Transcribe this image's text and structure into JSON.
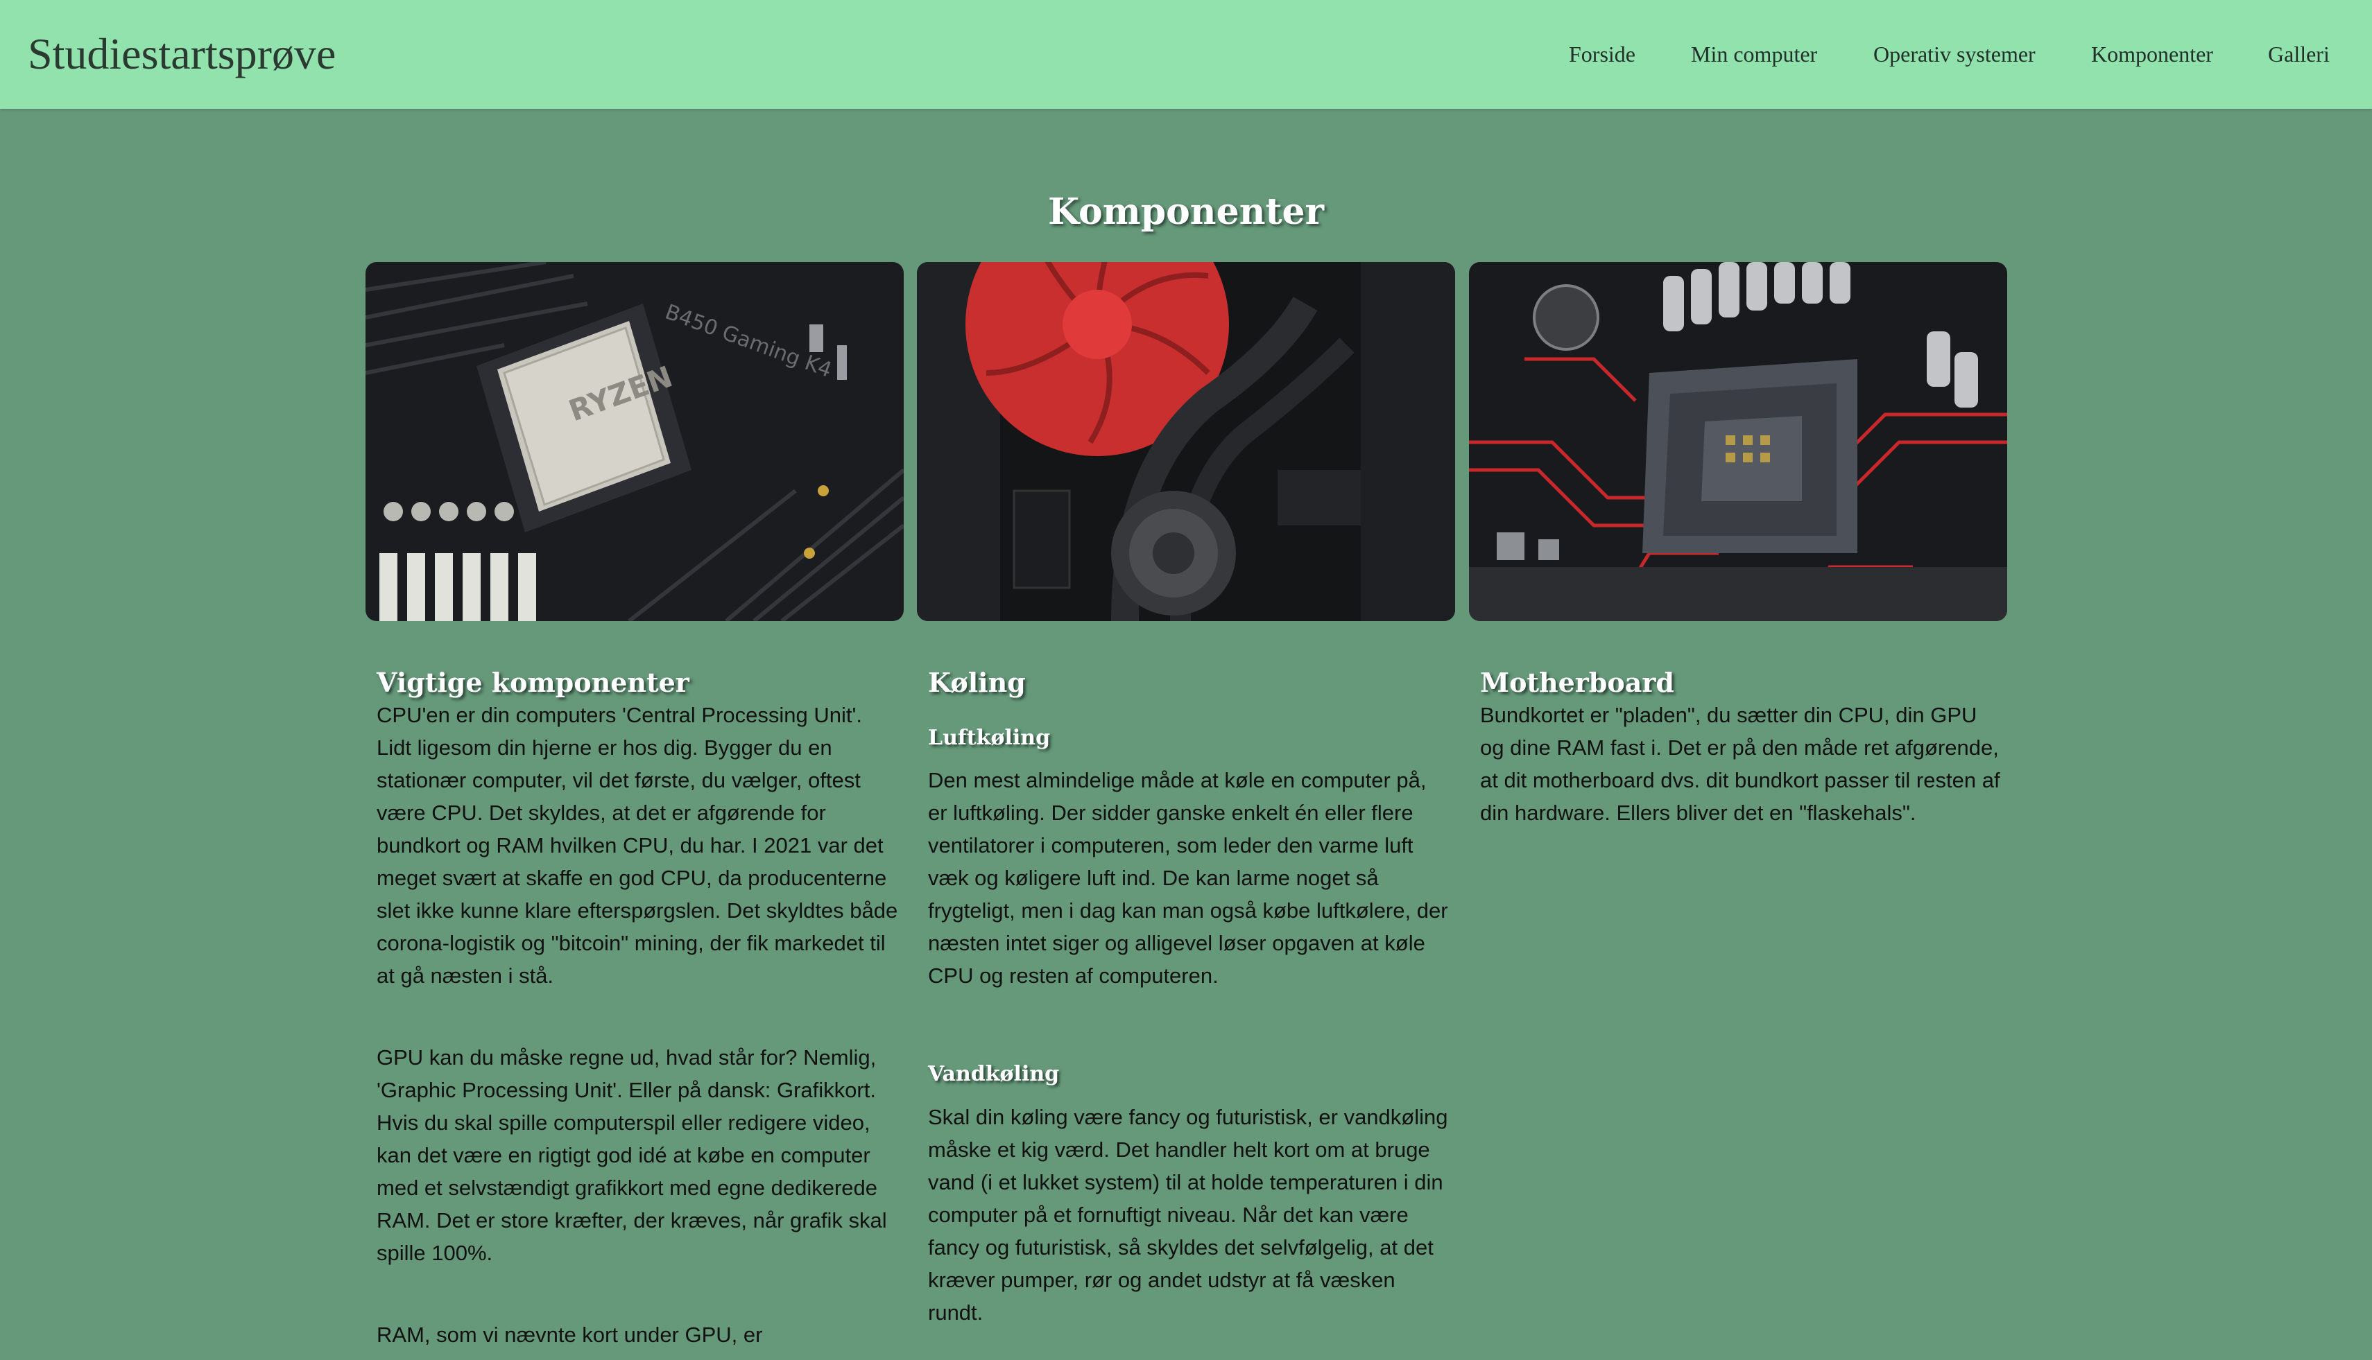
{
  "header": {
    "brand": "Studiestartsprøve",
    "nav": [
      "Forside",
      "Min computer",
      "Operativ systemer",
      "Komponenter",
      "Galleri"
    ]
  },
  "main": {
    "title": "Komponenter",
    "columns": [
      {
        "title": "Vigtige komponenter",
        "paragraphs": [
          "CPU'en er din computers 'Central Processing Unit'. Lidt ligesom din hjerne er hos dig. Bygger du en stationær computer, vil det første, du vælger, oftest være CPU. Det skyldes, at det er afgørende for bundkort og RAM hvilken CPU, du har. I 2021 var det meget svært at skaffe en god CPU, da producenterne slet ikke kunne klare efterspørgslen. Det skyldtes både corona-logistik og \"bitcoin\" mining, der fik markedet til at gå næsten i stå.",
          "GPU kan du måske regne ud, hvad står for? Nemlig, 'Graphic Processing Unit'. Eller på dansk: Grafikkort. Hvis du skal spille computerspil eller redigere video, kan det være en rigtigt god idé at købe en computer med et selvstændigt grafikkort med egne dedikerede RAM. Det er store kræfter, der kræves, når grafik skal spille 100%.",
          "RAM, som vi nævnte kort under GPU, er"
        ]
      },
      {
        "title": "Køling",
        "sub1": "Luftkøling",
        "para1": "Den mest almindelige måde at køle en computer på, er luftkøling. Der sidder ganske enkelt én eller flere ventilatorer i computeren, som leder den varme luft væk og køligere luft ind. De kan larme noget så frygteligt, men i dag kan man også købe luftkølere, der næsten intet siger og alligevel løser opgaven at køle CPU og resten af computeren.",
        "sub2": "Vandkøling",
        "para2": "Skal din køling være fancy og futuristisk, er vandkøling måske et kig værd. Det handler helt kort om at bruge vand (i et lukket system) til at holde temperaturen i din computer på et fornuftigt niveau. Når det kan være fancy og futuristisk, så skyldes det selvfølgelig, at det kræver pumper, rør og andet udstyr at få væsken rundt."
      },
      {
        "title": "Motherboard",
        "para": "Bundkortet er \"pladen\", du sætter din CPU, din GPU og dine RAM fast i. Det er på den måde ret afgørende, at dit motherboard dvs. dit bundkort passer til resten af din hardware. Ellers bliver det en \"flaskehals\"."
      }
    ]
  },
  "images": {
    "cpu_text": "RYZEN",
    "board_text": "B450 Gaming K4",
    "colors": {
      "navbar": "#92e2ae",
      "background": "#65997a",
      "fan": "#d43b3b",
      "trace": "#c8282a"
    }
  }
}
